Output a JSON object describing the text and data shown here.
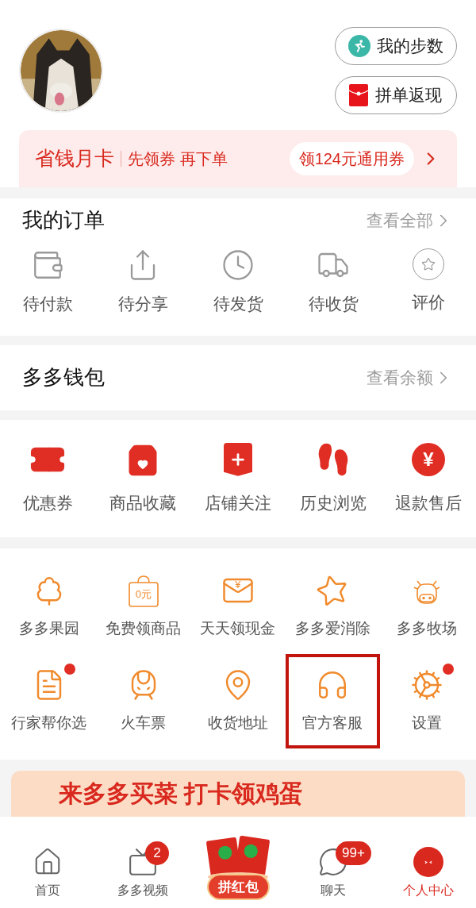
{
  "profile": {
    "buttons": [
      "我的步数",
      "拼单返现"
    ]
  },
  "promo_card": {
    "title": "省钱月卡",
    "subtitle": "先领券 再下单",
    "action": "领124元通用券"
  },
  "orders": {
    "title": "我的订单",
    "link": "查看全部",
    "items": [
      "待付款",
      "待分享",
      "待发货",
      "待收货",
      "评价"
    ]
  },
  "wallet": {
    "title": "多多钱包",
    "link": "查看余额"
  },
  "shortcuts": [
    {
      "label": "优惠券"
    },
    {
      "label": "商品收藏"
    },
    {
      "label": "店铺关注"
    },
    {
      "label": "历史浏览"
    },
    {
      "label": "退款售后",
      "icon_text": "¥"
    }
  ],
  "services": [
    {
      "label": "多多果园",
      "dot": false,
      "highlighted": false
    },
    {
      "label": "免费领商品",
      "icon_text": "0元",
      "dot": false,
      "highlighted": false
    },
    {
      "label": "天天领现金",
      "icon_text": "¥",
      "dot": false,
      "highlighted": false
    },
    {
      "label": "多多爱消除",
      "dot": false,
      "highlighted": false
    },
    {
      "label": "多多牧场",
      "dot": false,
      "highlighted": false
    },
    {
      "label": "行家帮你选",
      "dot": true,
      "highlighted": false
    },
    {
      "label": "火车票",
      "dot": false,
      "highlighted": false
    },
    {
      "label": "收货地址",
      "dot": false,
      "highlighted": false
    },
    {
      "label": "官方客服",
      "dot": false,
      "highlighted": true
    },
    {
      "label": "设置",
      "dot": true,
      "highlighted": false
    }
  ],
  "banner": {
    "text": "来多多买菜 打卡领鸡蛋"
  },
  "tab_bar": [
    {
      "kind": "tab",
      "label": "首页",
      "selected": false
    },
    {
      "kind": "tab",
      "label": "多多视频",
      "badge": "2",
      "selected": false
    },
    {
      "kind": "center",
      "label": "拼红包",
      "selected": false
    },
    {
      "kind": "tab",
      "label": "聊天",
      "badge": "99+",
      "selected": false
    },
    {
      "kind": "tab",
      "label": "个人中心",
      "selected": true
    }
  ]
}
